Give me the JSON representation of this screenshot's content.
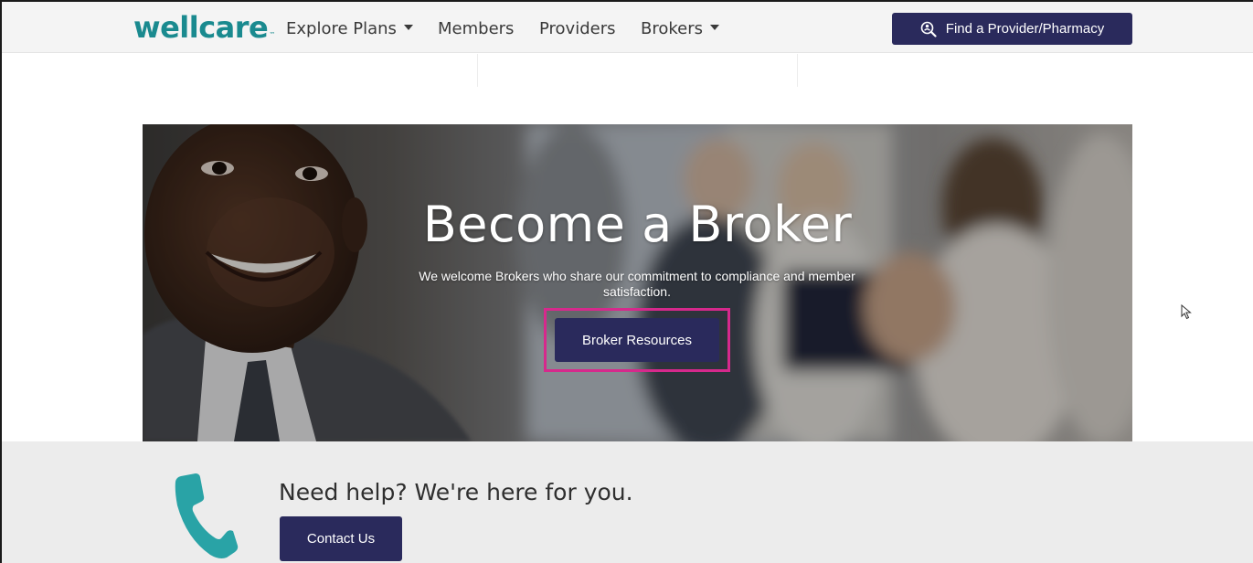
{
  "header": {
    "logo_text": "wellcare",
    "logo_tm": "™",
    "nav": [
      {
        "label": "Explore Plans",
        "has_dropdown": true
      },
      {
        "label": "Members",
        "has_dropdown": false
      },
      {
        "label": "Providers",
        "has_dropdown": false
      },
      {
        "label": "Brokers",
        "has_dropdown": true
      }
    ],
    "find_button_label": "Find a Provider/Pharmacy",
    "find_button_icon": "search-person-icon"
  },
  "hero": {
    "title": "Become a Broker",
    "subtitle": "We welcome Brokers who share our commitment to compliance and member satisfaction.",
    "button_label": "Broker Resources",
    "highlight_color": "#d6298c"
  },
  "help": {
    "title": "Need help? We're here for you.",
    "button_label": "Contact Us",
    "icon": "phone-icon"
  },
  "colors": {
    "brand": "#1a8a8f",
    "button": "#2a2a5c",
    "nav_bg": "#f4f4f4",
    "help_bg": "#ececec"
  }
}
